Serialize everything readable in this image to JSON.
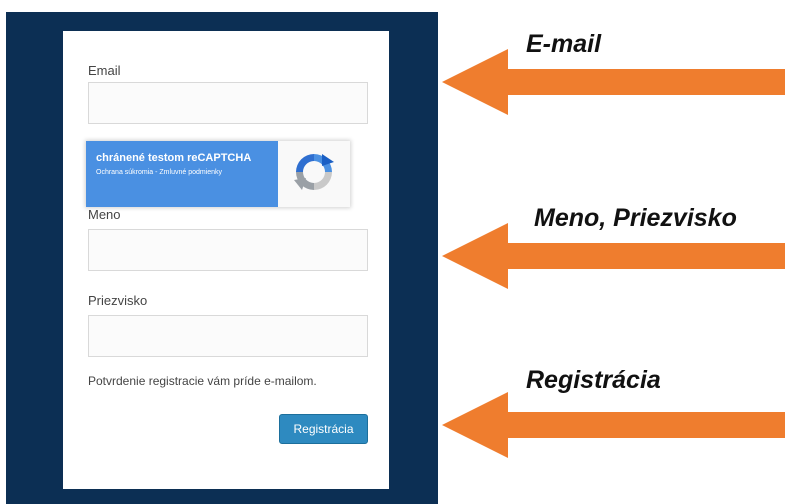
{
  "form": {
    "email_label": "Email",
    "email_value": "",
    "recaptcha": {
      "title": "chránené testom reCAPTCHA",
      "links": "Ochrana súkromia - Zmluvné podmienky",
      "logo_icon": "recaptcha-logo-icon",
      "color": "#4a90e2"
    },
    "first_name_label": "Meno",
    "first_name_value": "",
    "last_name_label": "Priezvisko",
    "last_name_value": "",
    "notice": "Potvrdenie registracie vám príde e-mailom.",
    "submit_label": "Registrácia",
    "submit_color": "#2e8ac0"
  },
  "annotations": [
    {
      "label": "E-mail",
      "arrow_icon": "left-arrow-icon",
      "color": "#ef7d2e"
    },
    {
      "label": "Meno, Priezvisko",
      "arrow_icon": "left-arrow-icon",
      "color": "#ef7d2e"
    },
    {
      "label": "Registrácia",
      "arrow_icon": "left-arrow-icon",
      "color": "#ef7d2e"
    }
  ],
  "panel_color": "#0c2f54"
}
